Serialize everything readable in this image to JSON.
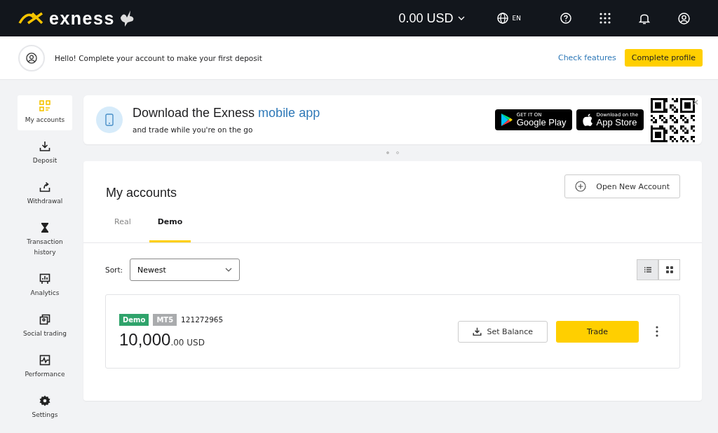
{
  "header": {
    "logo": "exness",
    "balance": "0.00 USD",
    "language": "EN"
  },
  "notice": {
    "text": "Hello! Complete your account to make your first deposit",
    "link": "Check features",
    "button": "Complete profile"
  },
  "sidebar": {
    "items": [
      {
        "label": "My accounts",
        "selected": true
      },
      {
        "label": "Deposit",
        "selected": false
      },
      {
        "label": "Withdrawal",
        "selected": false
      },
      {
        "label": "Transaction history",
        "selected": false
      },
      {
        "label": "Analytics",
        "selected": false
      },
      {
        "label": "Social trading",
        "selected": false
      },
      {
        "label": "Performance",
        "selected": false
      },
      {
        "label": "Settings",
        "selected": false
      }
    ]
  },
  "banner": {
    "title": "Download the Exness",
    "title_highlight": "mobile app",
    "subtitle": "and trade while you're on the go",
    "stores": [
      {
        "kind": "google",
        "small": "GET IT ON",
        "label": "Google Play"
      },
      {
        "kind": "apple",
        "small": "Download on the",
        "label": "App Store"
      }
    ],
    "dots": [
      {
        "selected": true
      },
      {
        "selected": false
      }
    ]
  },
  "accounts": {
    "title": "My accounts",
    "open_button": "Open New Account",
    "tabs": [
      {
        "label": "Real",
        "selected": false
      },
      {
        "label": "Demo",
        "selected": true
      }
    ],
    "sort_label": "Sort:",
    "sort_value": "Newest",
    "views": [
      {
        "kind": "list",
        "selected": true
      },
      {
        "kind": "grid",
        "selected": false
      }
    ],
    "account": {
      "badges": [
        {
          "kind": "type",
          "label": "Demo"
        },
        {
          "kind": "platform",
          "label": "MT5"
        }
      ],
      "number": "121272965",
      "balance": "10,000",
      "decimals": ".00",
      "currency": "USD",
      "set_balance": "Set Balance",
      "trade": "Trade"
    }
  }
}
